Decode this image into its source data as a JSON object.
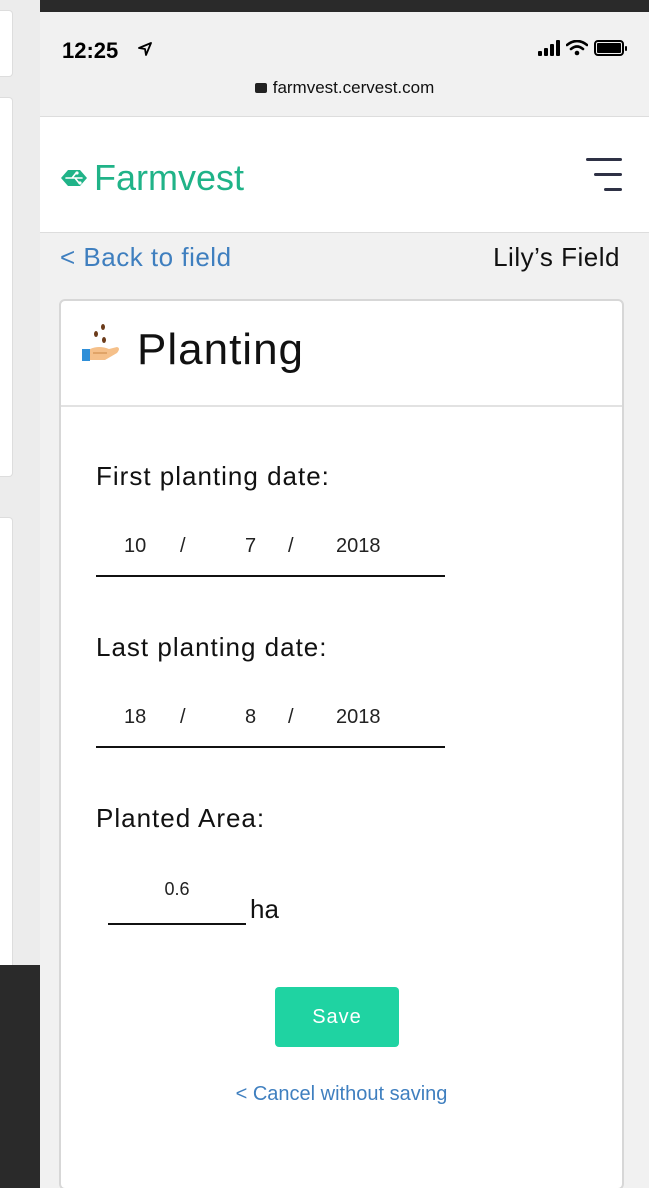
{
  "status_bar": {
    "time": "12:25",
    "url": "farmvest.cervest.com"
  },
  "navbar": {
    "brand_name": "Farmvest",
    "brand_color": "#20b388",
    "menu_icon": "hamburger-menu-icon"
  },
  "breadcrumb": {
    "back_label": "< Back to field",
    "field_name": "Lily’s Field"
  },
  "card": {
    "title": "Planting",
    "title_icon": "hand-planting-seeds-icon",
    "first_planting": {
      "label": "First planting date:",
      "day": "10",
      "month": "7",
      "year": "2018",
      "separator": "/"
    },
    "last_planting": {
      "label": "Last planting date:",
      "day": "18",
      "month": "8",
      "year": "2018",
      "separator": "/"
    },
    "planted_area": {
      "label": "Planted Area:",
      "value": "0.6",
      "unit": "ha"
    },
    "save_label": "Save",
    "save_color": "#1fd3a2",
    "cancel_label": "< Cancel without saving",
    "link_color": "#3f7fbf"
  }
}
